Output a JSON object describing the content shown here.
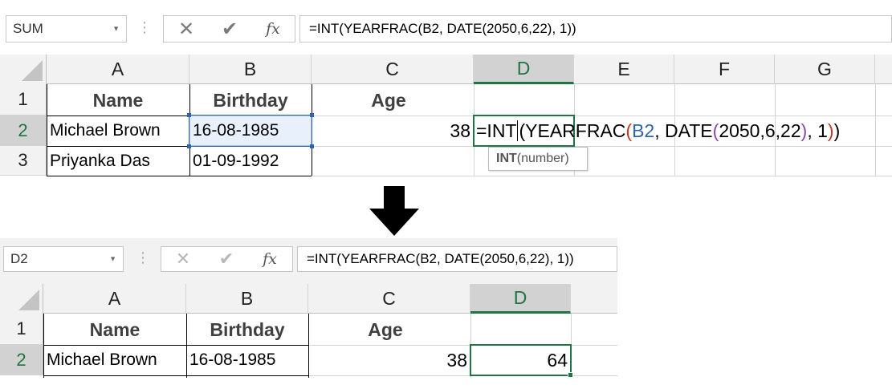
{
  "top": {
    "formula_bar": {
      "name_box": "SUM",
      "cancel_icon": "✕",
      "enter_icon": "✔",
      "fx_label": "fx",
      "formula": "=INT(YEARFRAC(B2, DATE(2050,6,22), 1))"
    },
    "columns": [
      "A",
      "B",
      "C",
      "D",
      "E",
      "F",
      "G"
    ],
    "rows": [
      "1",
      "2",
      "3"
    ],
    "headers": {
      "name": "Name",
      "birthday": "Birthday",
      "age": "Age"
    },
    "data": [
      {
        "name": "Michael Brown",
        "birthday": "16-08-1985",
        "age": "38"
      },
      {
        "name": "Priyanka Das",
        "birthday": "01-09-1992"
      }
    ],
    "edit_formula": {
      "p1": "=INT",
      "p2": "(",
      "p3": "YEARFRAC",
      "p4": "(",
      "p5": "B2",
      "p6": ", DATE",
      "p7": "(",
      "p8": "2050,6,22",
      "p9": ")",
      "p10": ", 1",
      "p11": ")",
      "p12": ")"
    },
    "tooltip": {
      "fn": "INT",
      "args": "(number)"
    }
  },
  "arrow_icon": "arrow-down-icon",
  "bottom": {
    "formula_bar": {
      "name_box": "D2",
      "cancel_icon": "✕",
      "enter_icon": "✔",
      "fx_label": "fx",
      "formula": "=INT(YEARFRAC(B2, DATE(2050,6,22), 1))"
    },
    "columns": [
      "A",
      "B",
      "C",
      "D"
    ],
    "rows": [
      "1",
      "2"
    ],
    "headers": {
      "name": "Name",
      "birthday": "Birthday",
      "age": "Age"
    },
    "data": [
      {
        "name": "Michael Brown",
        "birthday": "16-08-1985",
        "age": "38",
        "result": "64"
      }
    ]
  },
  "colors": {
    "accent": "#217346",
    "ref_blue": "#2e64b4",
    "paren_red": "#c0392b",
    "paren_purple": "#8e44ad"
  }
}
